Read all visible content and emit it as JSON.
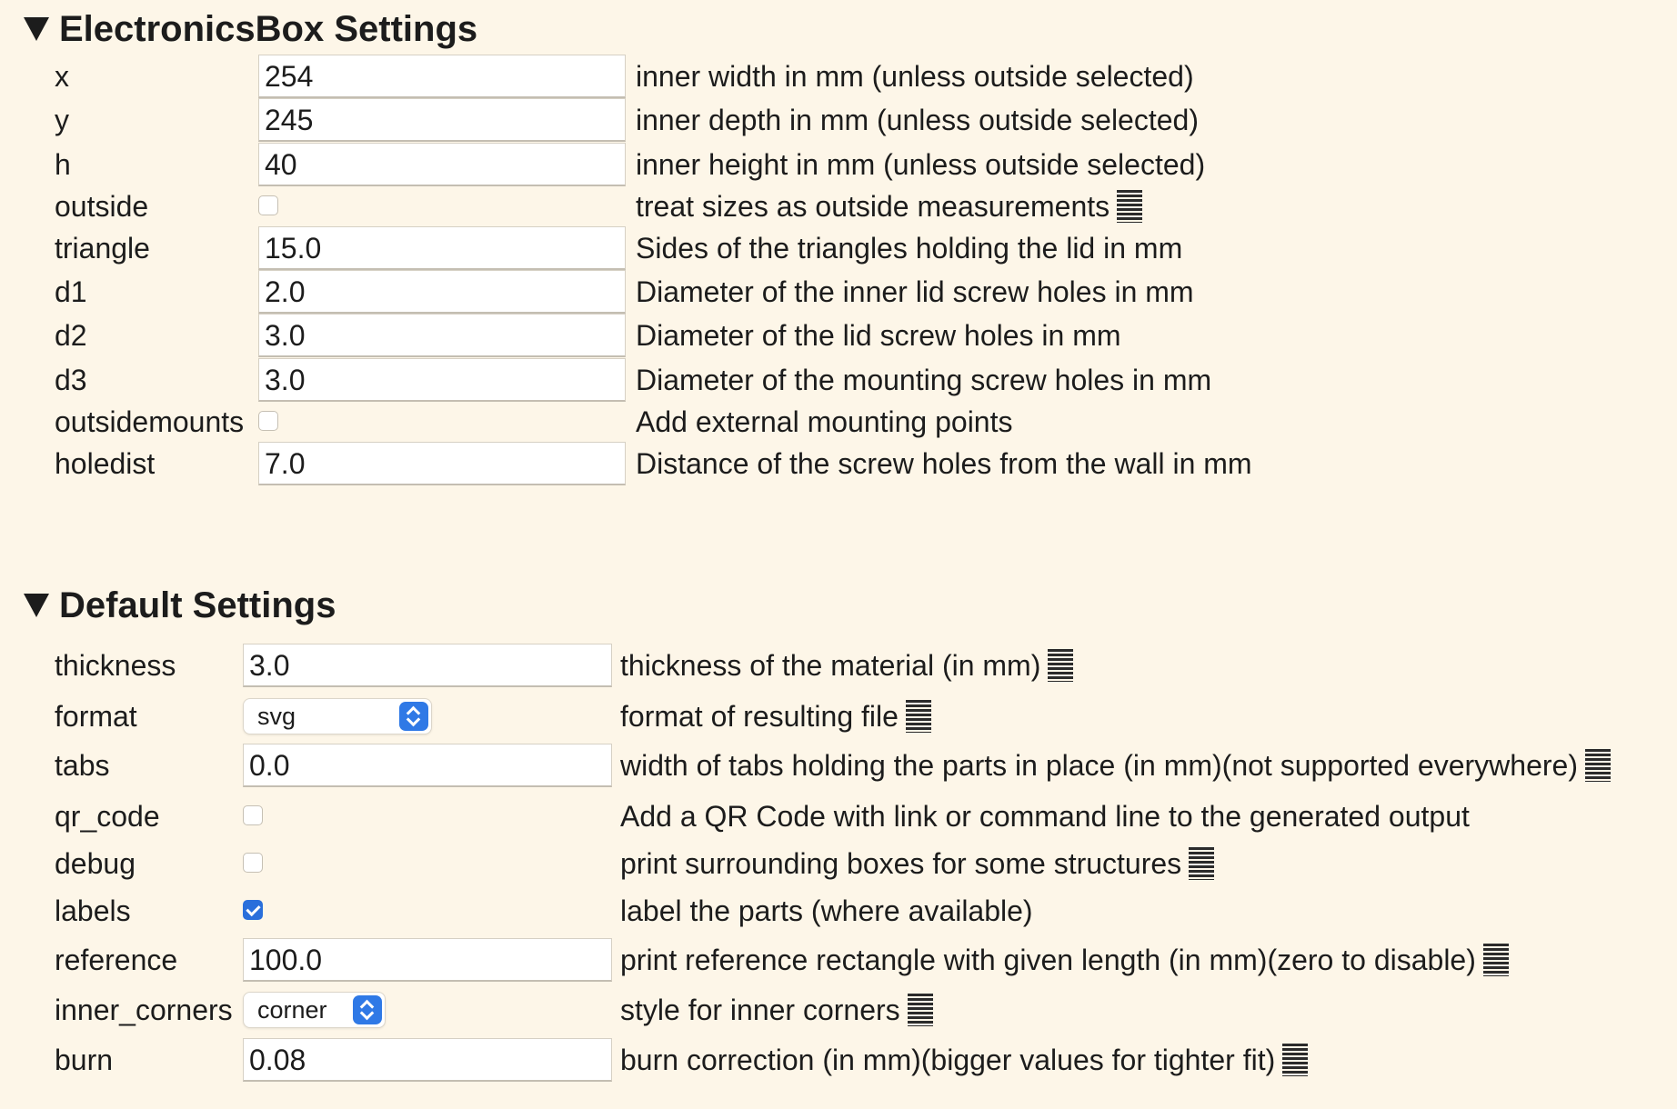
{
  "sections": [
    {
      "title": "ElectronicsBox Settings",
      "rows": [
        {
          "label": "x",
          "kind": "text",
          "value": "254",
          "desc": "inner width in mm (unless outside selected)",
          "info": false
        },
        {
          "label": "y",
          "kind": "text",
          "value": "245",
          "desc": "inner depth in mm (unless outside selected)",
          "info": false
        },
        {
          "label": "h",
          "kind": "text",
          "value": "40",
          "desc": "inner height in mm (unless outside selected)",
          "info": false
        },
        {
          "label": "outside",
          "kind": "checkbox",
          "checked": false,
          "desc": "treat sizes as outside measurements",
          "info": true
        },
        {
          "label": "triangle",
          "kind": "text",
          "value": "15.0",
          "desc": "Sides of the triangles holding the lid in mm",
          "info": false
        },
        {
          "label": "d1",
          "kind": "text",
          "value": "2.0",
          "desc": "Diameter of the inner lid screw holes in mm",
          "info": false
        },
        {
          "label": "d2",
          "kind": "text",
          "value": "3.0",
          "desc": "Diameter of the lid screw holes in mm",
          "info": false
        },
        {
          "label": "d3",
          "kind": "text",
          "value": "3.0",
          "desc": "Diameter of the mounting screw holes in mm",
          "info": false
        },
        {
          "label": "outsidemounts",
          "kind": "checkbox",
          "checked": false,
          "desc": "Add external mounting points",
          "info": false
        },
        {
          "label": "holedist",
          "kind": "text",
          "value": "7.0",
          "desc": "Distance of the screw holes from the wall in mm",
          "info": false
        }
      ]
    },
    {
      "title": "Default Settings",
      "rows": [
        {
          "label": "thickness",
          "kind": "text",
          "value": "3.0",
          "desc": "thickness of the material (in mm)",
          "info": true
        },
        {
          "label": "format",
          "kind": "select",
          "value": "svg",
          "desc": "format of resulting file",
          "info": true
        },
        {
          "label": "tabs",
          "kind": "text",
          "value": "0.0",
          "desc": "width of tabs holding the parts in place (in mm)(not supported everywhere)",
          "info": true
        },
        {
          "label": "qr_code",
          "kind": "checkbox",
          "checked": false,
          "desc": "Add a QR Code with link or command line to the generated output",
          "info": false
        },
        {
          "label": "debug",
          "kind": "checkbox",
          "checked": false,
          "desc": "print surrounding boxes for some structures",
          "info": true
        },
        {
          "label": "labels",
          "kind": "checkbox",
          "checked": true,
          "desc": "label the parts (where available)",
          "info": false
        },
        {
          "label": "reference",
          "kind": "text",
          "value": "100.0",
          "desc": "print reference rectangle with given length (in mm)(zero to disable)",
          "info": true
        },
        {
          "label": "inner_corners",
          "kind": "select",
          "value": "corner",
          "desc": "style for inner corners",
          "info": true
        },
        {
          "label": "burn",
          "kind": "text",
          "value": "0.08",
          "desc": "burn correction (in mm)(bigger values for tighter fit)",
          "info": true
        }
      ]
    }
  ],
  "colors": {
    "background": "#fdf6e8",
    "accent": "#2f79e6",
    "text": "#1c1c1c"
  },
  "icons": {
    "section_toggle": "triangle-down-icon",
    "info": "info-lines-icon",
    "select_stepper": "updown-stepper-icon"
  }
}
